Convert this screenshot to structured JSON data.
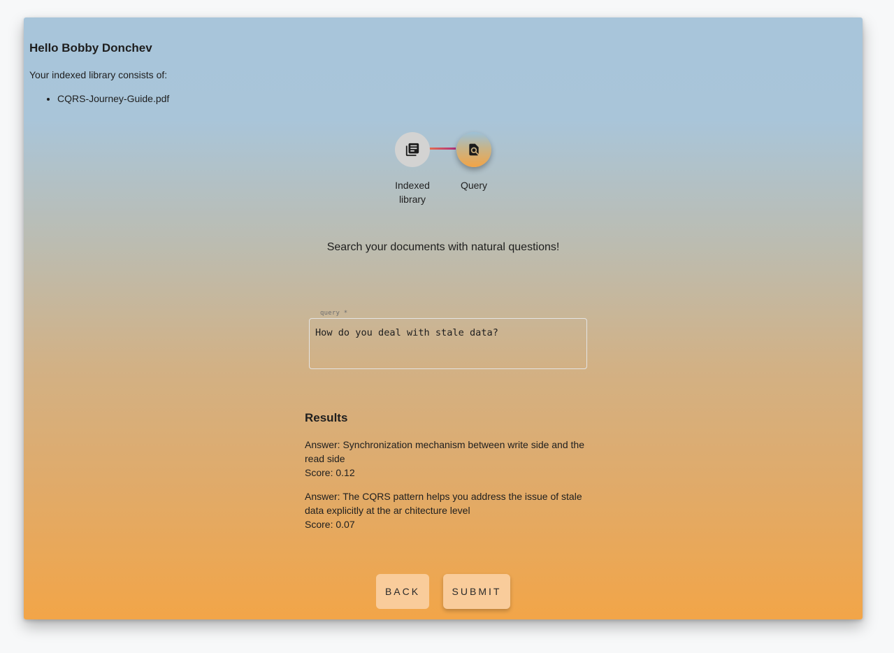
{
  "greeting": "Hello Bobby Donchev",
  "library": {
    "intro": "Your indexed library consists of:",
    "files": [
      "CQRS-Journey-Guide.pdf"
    ]
  },
  "stepper": {
    "steps": [
      {
        "label": "Indexed library",
        "icon": "library-books-icon",
        "active": false
      },
      {
        "label": "Query",
        "icon": "find-in-page-icon",
        "active": true
      }
    ]
  },
  "tagline": "Search your documents with natural questions!",
  "query_field": {
    "label": "query *",
    "value": "How do you deal with stale data?"
  },
  "results": {
    "title": "Results",
    "items": [
      {
        "answer": "Answer: Synchronization mechanism between write side and the read side",
        "score": "Score: 0.12"
      },
      {
        "answer": "Answer: The CQRS pattern helps you address the issue of stale data explicitly at the ar chitecture level",
        "score": "Score: 0.07"
      }
    ]
  },
  "buttons": {
    "back": "BACK",
    "submit": "SUBMIT"
  },
  "colors": {
    "gradient_top": "#a8c5da",
    "gradient_bottom": "#f2a548",
    "button_bg": "#f9cc9b",
    "inactive_step": "#d3d3d2"
  }
}
